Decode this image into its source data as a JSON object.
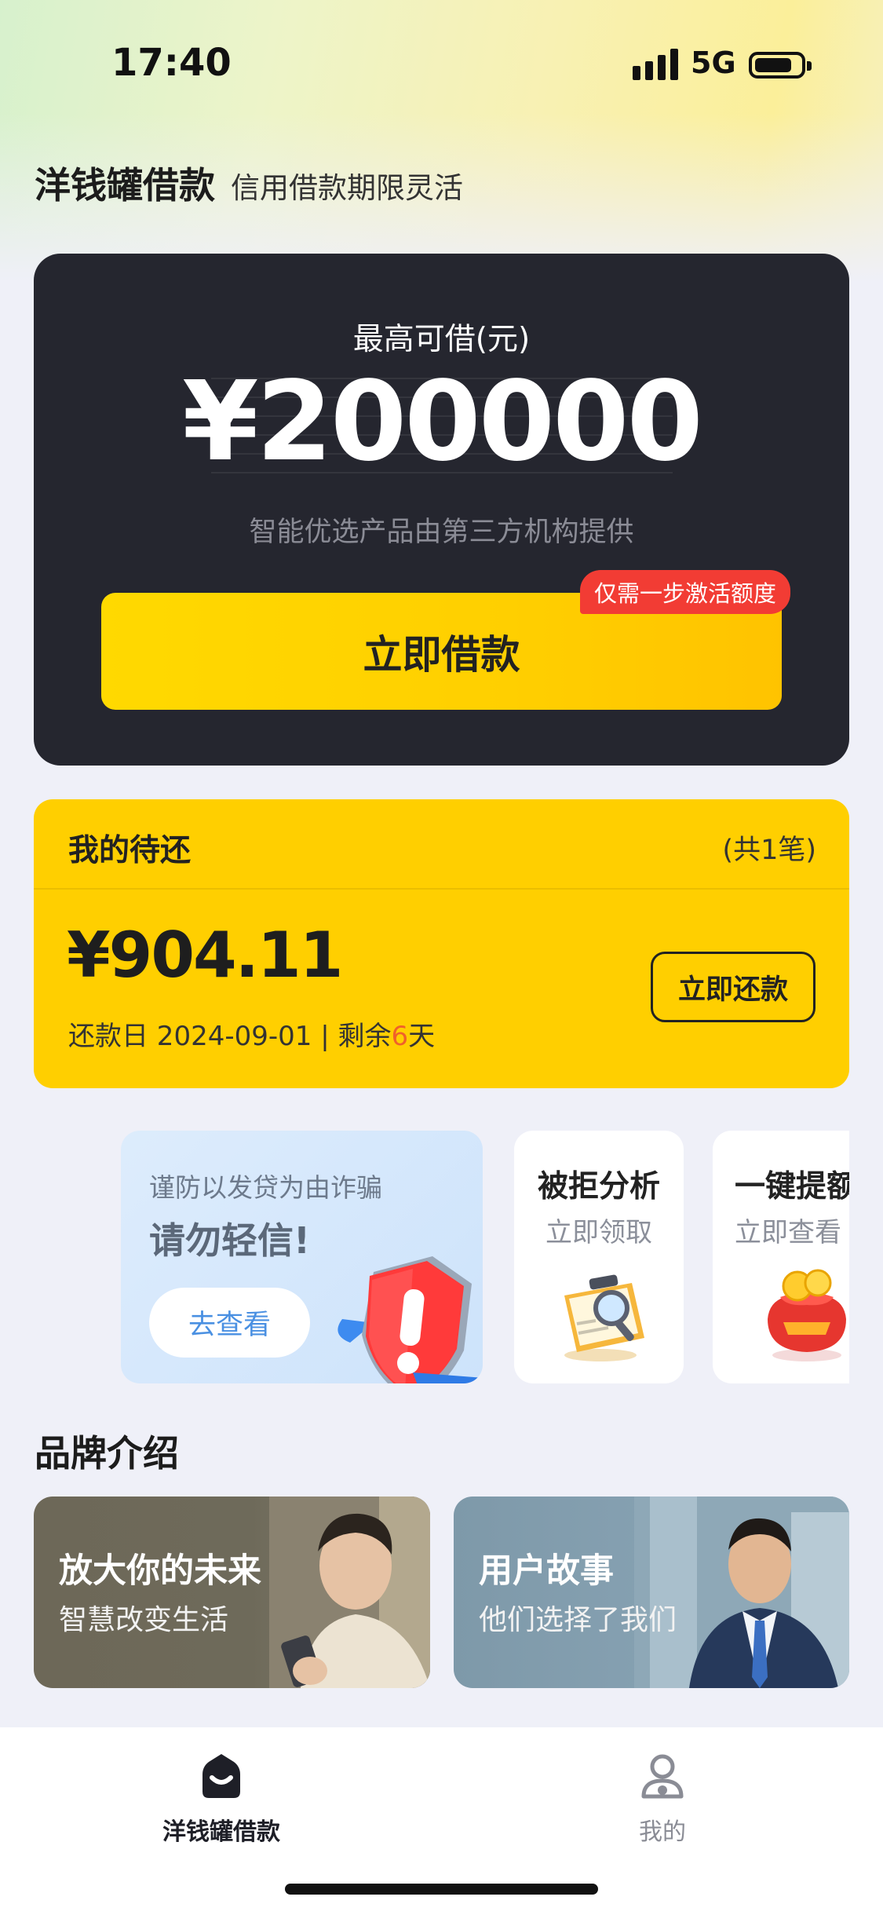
{
  "status_bar": {
    "time": "17:40",
    "network": "5G"
  },
  "header": {
    "title": "洋钱罐借款",
    "subtitle": "信用借款期限灵活"
  },
  "loan_card": {
    "label": "最高可借(元)",
    "amount": "¥200000",
    "note": "智能优选产品由第三方机构提供",
    "button_label": "立即借款",
    "promo_tag": "仅需一步激活额度"
  },
  "repayment": {
    "title": "我的待还",
    "count": "(共1笔)",
    "amount": "¥904.11",
    "date_prefix": "还款日 2024-09-01 | 剩余",
    "days": "6",
    "date_suffix": "天",
    "button_label": "立即还款"
  },
  "cards": {
    "fraud": {
      "line1": "谨防以发贷为由诈骗",
      "line2": "请勿轻信!",
      "button": "去查看"
    },
    "rejection": {
      "title": "被拒分析",
      "subtitle": "立即领取"
    },
    "raise": {
      "title": "一键提额",
      "subtitle": "立即查看"
    }
  },
  "brand": {
    "section_title": "品牌介绍",
    "items": [
      {
        "title": "放大你的未来",
        "subtitle": "智慧改变生活"
      },
      {
        "title": "用户故事",
        "subtitle": "他们选择了我们"
      }
    ]
  },
  "tabbar": {
    "items": [
      {
        "label": "洋钱罐借款",
        "icon": "home-icon",
        "active": true
      },
      {
        "label": "我的",
        "icon": "profile-icon",
        "active": false
      }
    ]
  },
  "colors": {
    "accent_yellow": "#ffcf00",
    "dark_card": "#25262f",
    "promo_red": "#f23c34",
    "highlight_orange": "#f0612a",
    "link_blue": "#4a90e2"
  }
}
